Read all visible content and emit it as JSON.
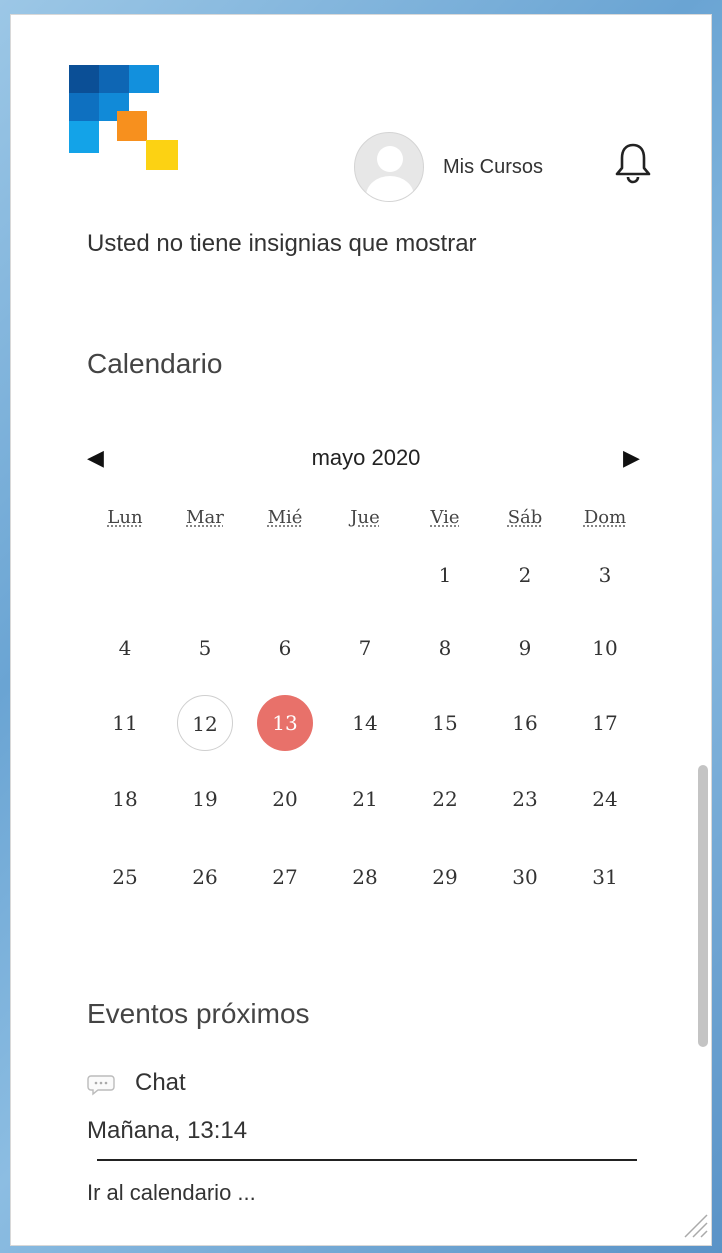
{
  "header": {
    "my_courses_label": "Mis Cursos",
    "icons": [
      "logo-icon",
      "avatar-icon",
      "bell-icon"
    ]
  },
  "badges": {
    "message": "Usted no tiene insignias que mostrar"
  },
  "calendar": {
    "title": "Calendario",
    "month_label": "mayo 2020",
    "prev_arrow": "◀",
    "next_arrow": "▶",
    "weekdays": [
      "Lun",
      "Mar",
      "Mié",
      "Jue",
      "Vie",
      "Sáb",
      "Dom"
    ],
    "weeks": [
      [
        "",
        "",
        "",
        "",
        "1",
        "2",
        "3"
      ],
      [
        "4",
        "5",
        "6",
        "7",
        "8",
        "9",
        "10"
      ],
      [
        "11",
        "12",
        "13",
        "14",
        "15",
        "16",
        "17"
      ],
      [
        "18",
        "19",
        "20",
        "21",
        "22",
        "23",
        "24"
      ],
      [
        "25",
        "26",
        "27",
        "28",
        "29",
        "30",
        "31"
      ]
    ],
    "today": "12",
    "selected": "13",
    "colors": {
      "selected_bg": "#e8716a",
      "today_border": "#cfcfcf"
    }
  },
  "events": {
    "title": "Eventos próximos",
    "items": [
      {
        "icon": "chat-bubble-icon",
        "name": "Chat",
        "time": "Mañana, 13:14"
      }
    ],
    "goto_calendar_label": "Ir al calendario ..."
  },
  "colors": {
    "logo_dark_blue": "#0b5fa8",
    "logo_mid_blue": "#1478c8",
    "logo_light_blue": "#11a4e6",
    "logo_orange": "#f7901e",
    "logo_yellow": "#fcd213"
  }
}
